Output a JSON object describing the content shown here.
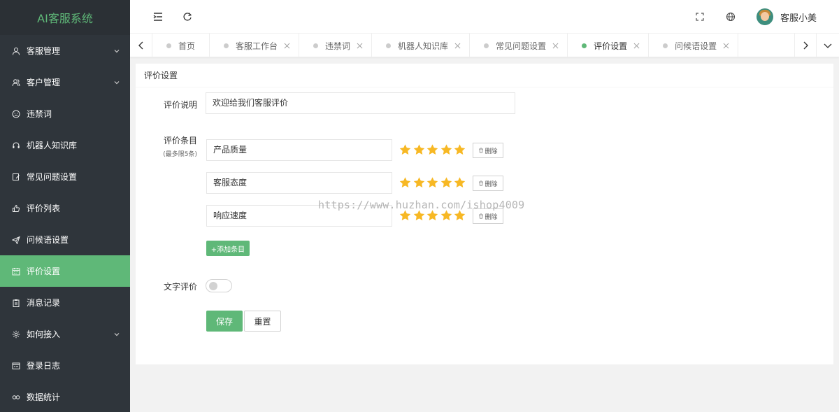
{
  "app": {
    "title": "AI客服系统"
  },
  "colors": {
    "accent": "#5fb878",
    "sidebar_bg": "#2f353b",
    "star": "#f7b824"
  },
  "sidebar": {
    "items": [
      {
        "label": "客服管理",
        "icon": "user-icon",
        "has_children": true
      },
      {
        "label": "客户管理",
        "icon": "users-icon",
        "has_children": true
      },
      {
        "label": "违禁词",
        "icon": "face-icon",
        "has_children": false
      },
      {
        "label": "机器人知识库",
        "icon": "headset-icon",
        "has_children": false
      },
      {
        "label": "常见问题设置",
        "icon": "edit-icon",
        "has_children": false
      },
      {
        "label": "评价列表",
        "icon": "thumb-up-icon",
        "has_children": false
      },
      {
        "label": "问候语设置",
        "icon": "send-icon",
        "has_children": false
      },
      {
        "label": "评价设置",
        "icon": "calendar-icon",
        "has_children": false,
        "active": true
      },
      {
        "label": "消息记录",
        "icon": "clipboard-icon",
        "has_children": false
      },
      {
        "label": "如何接入",
        "icon": "gear-icon",
        "has_children": true
      },
      {
        "label": "登录日志",
        "icon": "log-icon",
        "has_children": false
      },
      {
        "label": "数据统计",
        "icon": "link-icon",
        "has_children": false
      }
    ]
  },
  "header": {
    "user_name": "客服小美",
    "icons": [
      "menu-fold-icon",
      "refresh-icon",
      "fullscreen-icon",
      "globe-icon"
    ]
  },
  "tabs": [
    {
      "label": "首页",
      "closable": false
    },
    {
      "label": "客服工作台",
      "closable": true
    },
    {
      "label": "违禁词",
      "closable": true
    },
    {
      "label": "机器人知识库",
      "closable": true
    },
    {
      "label": "常见问题设置",
      "closable": true
    },
    {
      "label": "评价设置",
      "closable": true,
      "active": true
    },
    {
      "label": "问候语设置",
      "closable": true
    }
  ],
  "form": {
    "card_title": "评价设置",
    "desc_label": "评价说明",
    "desc_value": "欢迎给我们客服评价",
    "items_label": "评价条目",
    "items_sublabel": "(最多限5条)",
    "items": [
      {
        "name": "产品质量",
        "stars": 5
      },
      {
        "name": "客服态度",
        "stars": 5
      },
      {
        "name": "响应速度",
        "stars": 5
      }
    ],
    "delete_label": "删除",
    "add_label": "+添加条目",
    "text_eval_label": "文字评价",
    "text_eval_enabled": false,
    "save_label": "保存",
    "reset_label": "重置"
  },
  "watermark": "https://www.huzhan.com/ishop4009"
}
